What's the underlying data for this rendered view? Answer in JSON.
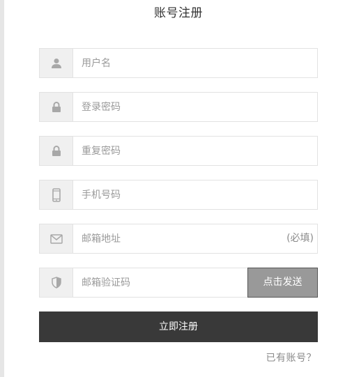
{
  "title": "账号注册",
  "fields": [
    {
      "name": "username",
      "icon": "user-icon",
      "placeholder": "用户名"
    },
    {
      "name": "password",
      "icon": "lock-icon",
      "placeholder": "登录密码"
    },
    {
      "name": "confirm_password",
      "icon": "lock-icon",
      "placeholder": "重复密码"
    },
    {
      "name": "phone",
      "icon": "phone-icon",
      "placeholder": "手机号码"
    },
    {
      "name": "email",
      "icon": "envelope-icon",
      "placeholder": "邮箱地址",
      "suffix": "(必填)"
    },
    {
      "name": "email_code",
      "icon": "shield-icon",
      "placeholder": "邮箱验证码"
    }
  ],
  "send_code_button": "点击发送",
  "submit_button": "立即注册",
  "login_link": "已有账号？",
  "colors": {
    "icon": "#a8a8a8",
    "icon_box_bg": "#f0f0f0",
    "border": "#e2e2e2",
    "send_button_bg": "#999999",
    "submit_button_bg": "#393939"
  }
}
